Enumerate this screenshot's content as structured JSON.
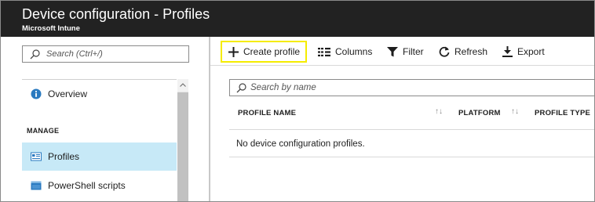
{
  "header": {
    "title": "Device configuration - Profiles",
    "subtitle": "Microsoft Intune"
  },
  "sidebar": {
    "search_placeholder": "Search (Ctrl+/)",
    "overview_label": "Overview",
    "section_label": "MANAGE",
    "items": [
      {
        "label": "Profiles",
        "icon": "profiles-icon",
        "selected": true
      },
      {
        "label": "PowerShell scripts",
        "icon": "powershell-icon",
        "selected": false
      }
    ]
  },
  "toolbar": {
    "create_label": "Create profile",
    "columns_label": "Columns",
    "filter_label": "Filter",
    "refresh_label": "Refresh",
    "export_label": "Export"
  },
  "grid": {
    "search_placeholder": "Search by name",
    "columns": [
      "PROFILE NAME",
      "PLATFORM",
      "PROFILE TYPE"
    ],
    "empty_message": "No device configuration profiles."
  },
  "colors": {
    "header_bg": "#222222",
    "selected_bg": "#c7e9f7",
    "highlight_border": "#f5ec00",
    "info_blue": "#2a7ac0"
  }
}
